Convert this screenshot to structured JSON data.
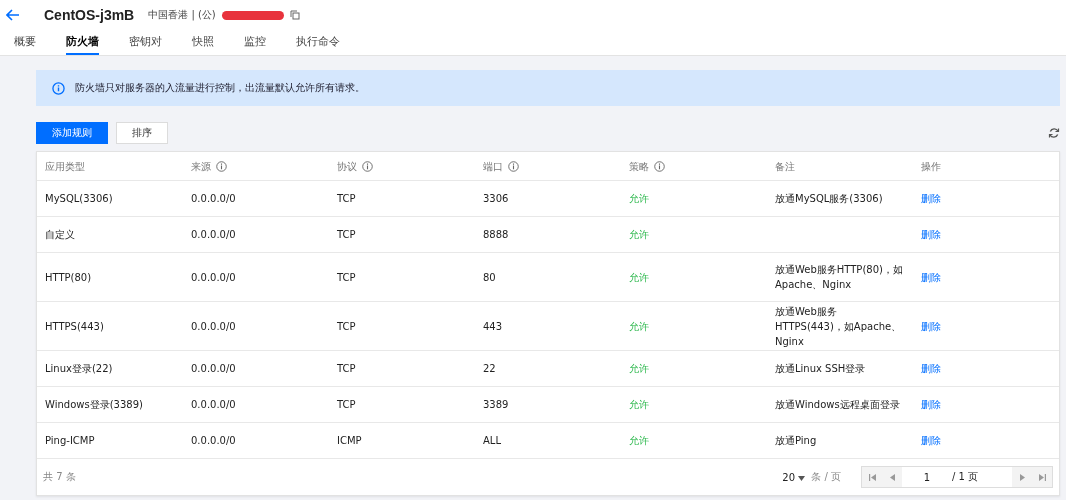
{
  "header": {
    "title": "CentOS-j3mB",
    "region": "中国香港 | (公)",
    "ip_redacted": true
  },
  "tabs": [
    {
      "label": "概要",
      "selected": false
    },
    {
      "label": "防火墙",
      "selected": true
    },
    {
      "label": "密钥对",
      "selected": false
    },
    {
      "label": "快照",
      "selected": false
    },
    {
      "label": "监控",
      "selected": false
    },
    {
      "label": "执行命令",
      "selected": false
    }
  ],
  "notice": "防火墙只对服务器的入流量进行控制，出流量默认允许所有请求。",
  "toolbar": {
    "primary_button": "添加规则",
    "secondary_button": "排序"
  },
  "table": {
    "columns": [
      {
        "label": "应用类型",
        "info": false
      },
      {
        "label": "来源",
        "info": true
      },
      {
        "label": "协议",
        "info": true
      },
      {
        "label": "端口",
        "info": true
      },
      {
        "label": "策略",
        "info": true
      },
      {
        "label": "备注",
        "info": false
      },
      {
        "label": "操作",
        "info": false
      }
    ],
    "rows": [
      {
        "type": "MySQL(3306)",
        "source": "0.0.0.0/0",
        "protocol": "TCP",
        "port": "3306",
        "policy": "允许",
        "note": "放通MySQL服务(3306)",
        "action": "删除"
      },
      {
        "type": "自定义",
        "source": "0.0.0.0/0",
        "protocol": "TCP",
        "port": "8888",
        "policy": "允许",
        "note": "",
        "action": "删除"
      },
      {
        "type": "HTTP(80)",
        "source": "0.0.0.0/0",
        "protocol": "TCP",
        "port": "80",
        "policy": "允许",
        "note": "放通Web服务HTTP(80)，如Apache、Nginx",
        "action": "删除"
      },
      {
        "type": "HTTPS(443)",
        "source": "0.0.0.0/0",
        "protocol": "TCP",
        "port": "443",
        "policy": "允许",
        "note": "放通Web服务HTTPS(443)，如Apache、Nginx",
        "action": "删除"
      },
      {
        "type": "Linux登录(22)",
        "source": "0.0.0.0/0",
        "protocol": "TCP",
        "port": "22",
        "policy": "允许",
        "note": "放通Linux SSH登录",
        "action": "删除"
      },
      {
        "type": "Windows登录(3389)",
        "source": "0.0.0.0/0",
        "protocol": "TCP",
        "port": "3389",
        "policy": "允许",
        "note": "放通Windows远程桌面登录",
        "action": "删除"
      },
      {
        "type": "Ping-ICMP",
        "source": "0.0.0.0/0",
        "protocol": "ICMP",
        "port": "ALL",
        "policy": "允许",
        "note": "放通Ping",
        "action": "删除"
      }
    ]
  },
  "pagination": {
    "total": "共 7 条",
    "page_size": "20",
    "page_size_unit": "条 / 页",
    "page": "1",
    "page_total": "/ 1 页"
  }
}
